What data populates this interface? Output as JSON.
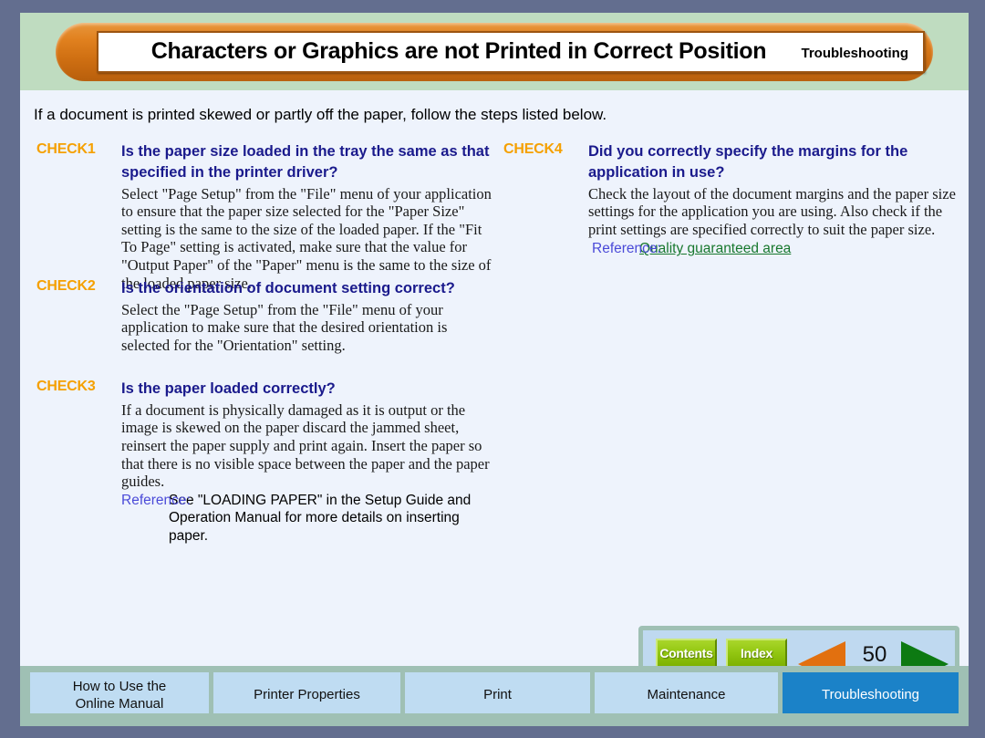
{
  "header": {
    "title": "Characters or Graphics are not Printed in Correct Position",
    "section": "Troubleshooting"
  },
  "content": {
    "intro": "If a document is printed skewed or partly off the paper, follow the steps listed below.",
    "checks": [
      {
        "label": "CHECK1",
        "heading": "Is the paper size loaded in the tray the same as that specified in the printer driver?",
        "body": "Select \"Page Setup\" from the \"File\" menu of your application to ensure that the paper size selected for the \"Paper Size\" setting is the same to the size of the loaded paper. If the \"Fit To Page\" setting is activated, make sure that the value for \"Output Paper\" of the \"Paper\" menu is the same to the size of the loaded paper size."
      },
      {
        "label": "CHECK2",
        "heading": "Is the orientation of document setting correct?",
        "body": "Select the \"Page Setup\" from the \"File\" menu of your application to make sure that the desired orientation is selected for the \"Orientation\" setting."
      },
      {
        "label": "CHECK3",
        "heading": "Is the paper loaded correctly?",
        "body": "If a document is physically damaged as it is output or the image is skewed on the paper discard the jammed sheet, reinsert the paper supply and print again. Insert the paper so that there is no visible space between the paper and the paper guides.",
        "reference_word": "Reference:",
        "reference_text": "See \"LOADING PAPER\" in the Setup Guide and Operation Manual for more details on inserting paper."
      },
      {
        "label": "CHECK4",
        "heading": "Did you correctly specify the margins for the application in use?",
        "body": "Check the layout of the document margins and the paper size settings for the application you are using. Also check if the print settings are specified correctly to suit the paper size.",
        "reference_word": "Reference:",
        "reference_link": "Quality guaranteed area"
      }
    ]
  },
  "nav": {
    "contents_label": "Contents",
    "index_label": "Index",
    "page_number": "50",
    "prev_icon": "triangle-left-icon",
    "next_icon": "triangle-right-icon"
  },
  "tabs": [
    {
      "line1": "How to Use the",
      "line2": "Online Manual",
      "active": false
    },
    {
      "line1": "Printer Properties",
      "line2": "",
      "active": false
    },
    {
      "line1": "Print",
      "line2": "",
      "active": false
    },
    {
      "line1": "Maintenance",
      "line2": "",
      "active": false
    },
    {
      "line1": "Troubleshooting",
      "line2": "",
      "active": true
    }
  ],
  "colors": {
    "outer_frame": "#636e8f",
    "header_band": "#bfdcc0",
    "title_pill": "#e1811f",
    "content_bg": "#eef3fc",
    "check_label": "#f5a000",
    "check_heading": "#1a1a8c",
    "reference_word": "#4a4ad8",
    "reference_link": "#18782e",
    "nav_button": "#93c712",
    "prev_arrow": "#e2700f",
    "next_arrow": "#0d7a12",
    "tab_bg": "#bfdcf2",
    "tab_active_bg": "#1b82c8",
    "tabbar_bg": "#9fc0b4"
  }
}
